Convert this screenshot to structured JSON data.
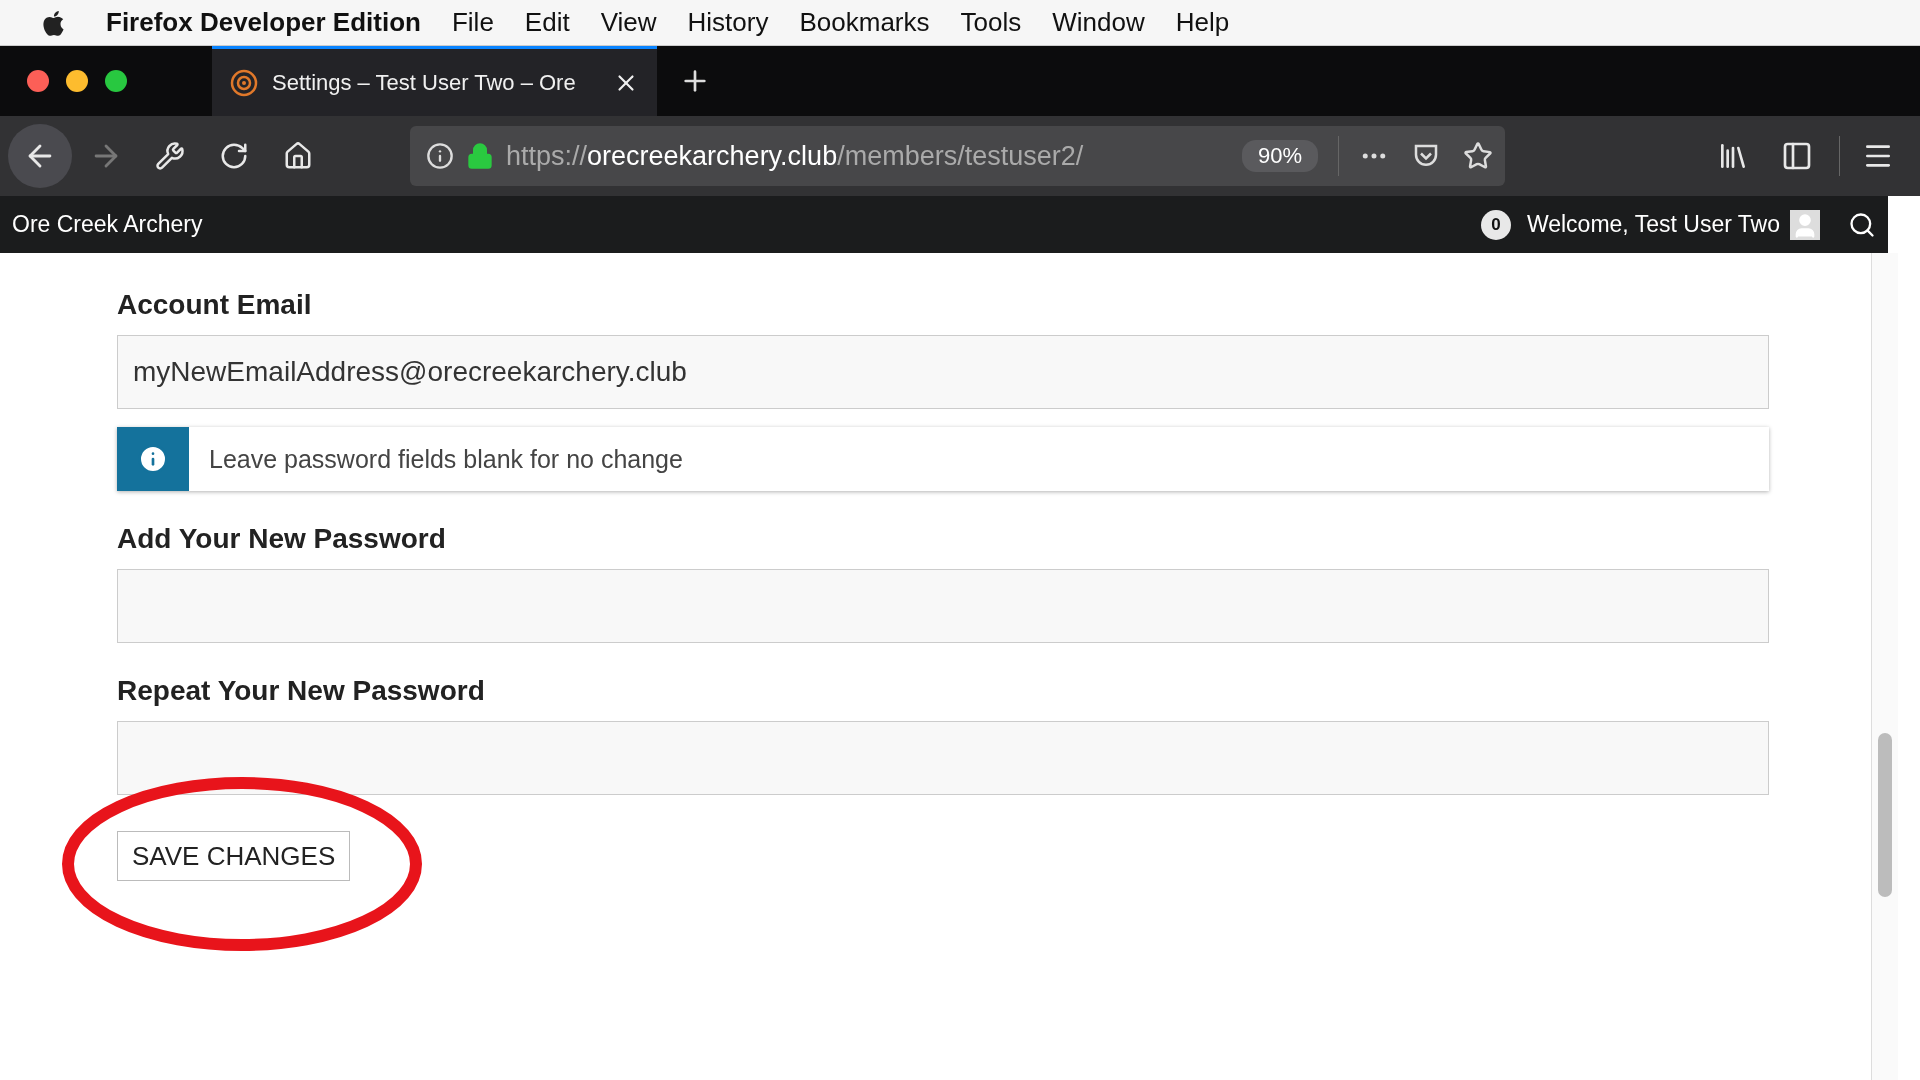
{
  "menu_bar": {
    "app_name": "Firefox Developer Edition",
    "items": [
      "File",
      "Edit",
      "View",
      "History",
      "Bookmarks",
      "Tools",
      "Window",
      "Help"
    ]
  },
  "tab": {
    "title": "Settings – Test User Two – Ore"
  },
  "address_bar": {
    "scheme": "https://",
    "host": "orecreekarchery.club",
    "path": "/members/testuser2/",
    "zoom": "90%"
  },
  "site_nav": {
    "title": "Ore Creek Archery",
    "notifications": "0",
    "welcome": "Welcome, Test User Two"
  },
  "form": {
    "fields": [
      {
        "kind": "field",
        "label": "Account Email",
        "value": "myNewEmailAddress@orecreekarchery.club"
      },
      {
        "kind": "note",
        "text": "Leave password fields blank for no change"
      },
      {
        "kind": "field",
        "label": "Add Your New Password"
      },
      {
        "kind": "field",
        "label": "Repeat Your New Password"
      }
    ],
    "button": "SAVE CHANGES"
  }
}
